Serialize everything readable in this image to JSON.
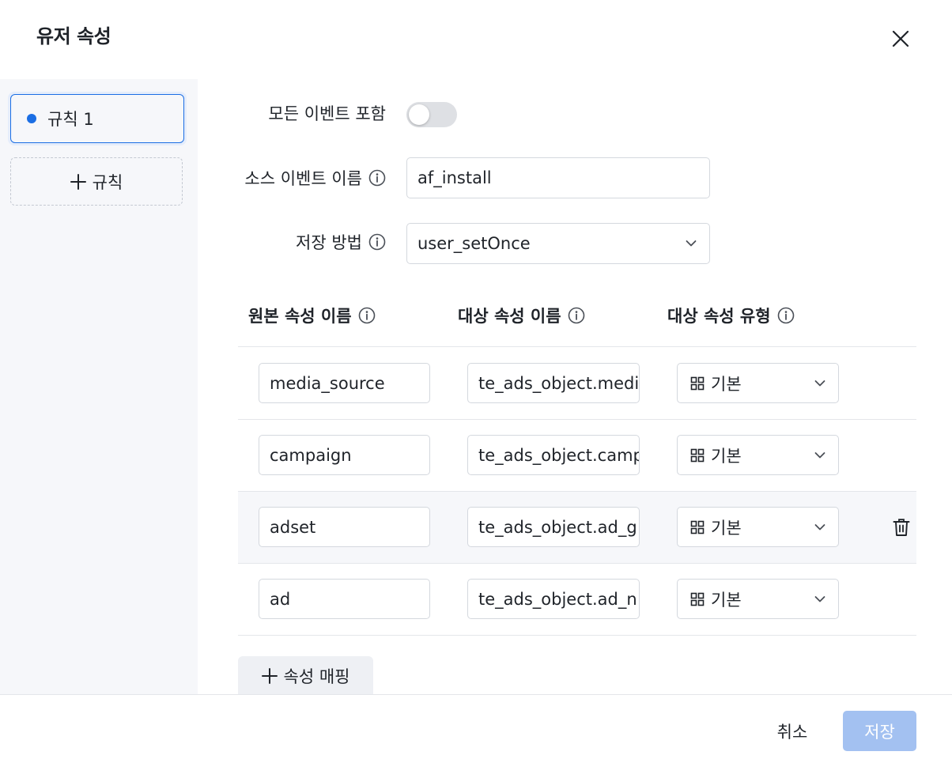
{
  "modal": {
    "title": "유저 속성"
  },
  "sidebar": {
    "rules": [
      {
        "label": "규칙 1",
        "active": true
      }
    ],
    "add_rule_label": "규칙"
  },
  "form": {
    "include_all_events_label": "모든 이벤트 포함",
    "include_all_events_on": false,
    "source_event_label": "소스 이벤트 이름",
    "source_event_value": "af_install",
    "save_method_label": "저장 방법",
    "save_method_value": "user_setOnce"
  },
  "table": {
    "headers": {
      "source_property": "원본 속성 이름",
      "target_property": "대상 속성 이름",
      "target_type": "대상 속성 유형"
    },
    "rows": [
      {
        "source": "media_source",
        "target": "te_ads_object.medi",
        "type": "기본"
      },
      {
        "source": "campaign",
        "target": "te_ads_object.camp",
        "type": "기본"
      },
      {
        "source": "adset",
        "target": "te_ads_object.ad_g",
        "type": "기본",
        "hovered": true
      },
      {
        "source": "ad",
        "target": "te_ads_object.ad_n",
        "type": "기본"
      }
    ],
    "add_mapping_label": "속성 매핑"
  },
  "footer": {
    "cancel_label": "취소",
    "save_label": "저장"
  },
  "colors": {
    "primary": "#1b6ee4",
    "primary_disabled": "#a3c1f1",
    "sidebar_bg": "#f6f7fa",
    "border": "#d4d8de"
  }
}
